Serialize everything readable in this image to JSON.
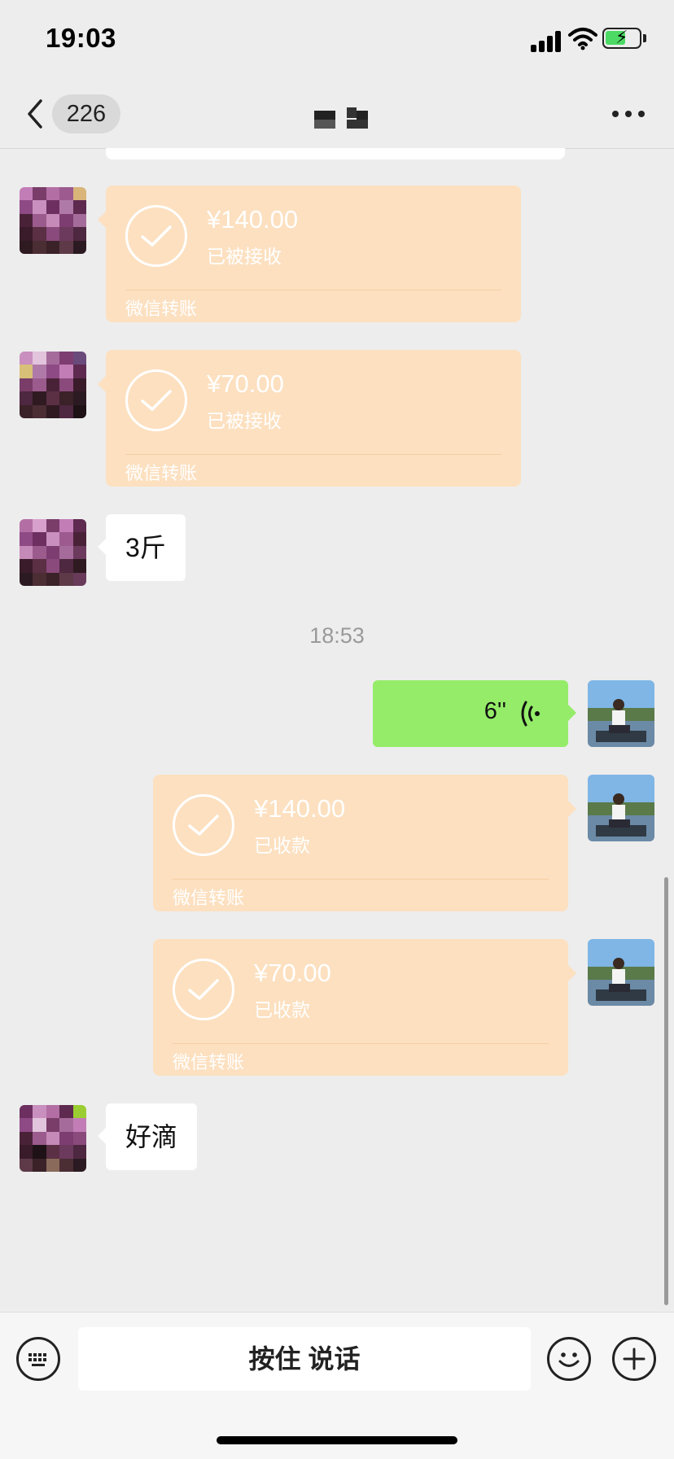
{
  "status_bar": {
    "time": "19:03"
  },
  "nav": {
    "back_count": "226",
    "chat_title": ""
  },
  "messages": [
    {
      "type": "transfer",
      "side": "left",
      "amount": "¥140.00",
      "status": "已被接收",
      "footer": "微信转账"
    },
    {
      "type": "transfer",
      "side": "left",
      "amount": "¥70.00",
      "status": "已被接收",
      "footer": "微信转账"
    },
    {
      "type": "text",
      "side": "left",
      "text": "3斤"
    },
    {
      "type": "timestamp",
      "text": "18:53"
    },
    {
      "type": "voice",
      "side": "right",
      "duration": "6''"
    },
    {
      "type": "transfer",
      "side": "right",
      "amount": "¥140.00",
      "status": "已收款",
      "footer": "微信转账"
    },
    {
      "type": "transfer",
      "side": "right",
      "amount": "¥70.00",
      "status": "已收款",
      "footer": "微信转账"
    },
    {
      "type": "text",
      "side": "left",
      "text": "好滴"
    }
  ],
  "input_bar": {
    "hold_to_talk": "按住 说话"
  },
  "icons": {
    "keyboard": "keyboard-icon",
    "emoji": "emoji-icon",
    "plus": "plus-icon",
    "back": "chevron-left-icon",
    "more": "more-icon"
  },
  "colors": {
    "background": "#ededed",
    "transfer_bubble": "#fce0c0",
    "voice_bubble": "#95ec69",
    "text_bubble": "#ffffff"
  }
}
